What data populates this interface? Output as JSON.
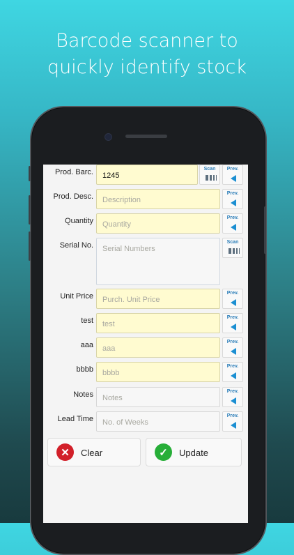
{
  "headline": {
    "line1": "Barcode scanner to",
    "line2": "quickly identify stock"
  },
  "form": {
    "rows": [
      {
        "label": "Prod. Barc.",
        "value": "1245",
        "button": "Scan",
        "button2": "Prev."
      },
      {
        "label": "Prod. Desc.",
        "placeholder": "Description",
        "button": "Prev."
      },
      {
        "label": "Quantity",
        "placeholder": "Quantity",
        "button": "Prev."
      },
      {
        "label": "Serial No.",
        "placeholder": "Serial Numbers",
        "button": "Scan"
      },
      {
        "label": "Unit Price",
        "placeholder": "Purch. Unit Price",
        "button": "Prev."
      },
      {
        "label": "test",
        "placeholder": "test",
        "button": "Prev."
      },
      {
        "label": "aaa",
        "placeholder": "aaa",
        "button": "Prev."
      },
      {
        "label": "bbbb",
        "placeholder": "bbbb",
        "button": "Prev."
      },
      {
        "label": "Notes",
        "placeholder": "Notes",
        "button": "Prev."
      },
      {
        "label": "Lead Time",
        "placeholder": "No. of Weeks",
        "button": "Prev."
      }
    ]
  },
  "actions": {
    "clear": "Clear",
    "update": "Update"
  },
  "colors": {
    "field_bg": "#fffbd0",
    "accent_blue": "#1b8fd2",
    "clear_red": "#d2202a",
    "update_green": "#27ae38"
  }
}
